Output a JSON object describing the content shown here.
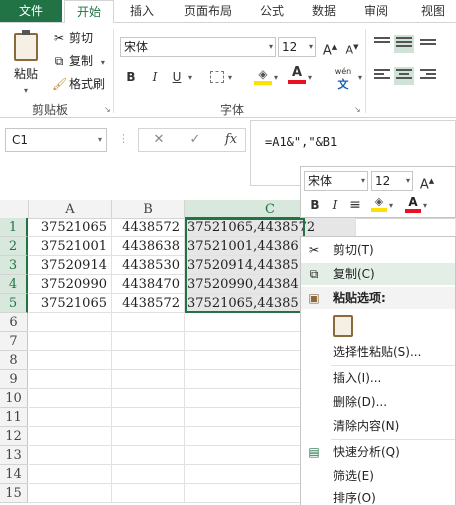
{
  "tabs": {
    "file": "文件",
    "home": "开始",
    "insert": "插入",
    "page_layout": "页面布局",
    "formulas": "公式",
    "data": "数据",
    "review": "审阅",
    "view": "视图"
  },
  "ribbon": {
    "clipboard": {
      "paste": "粘贴",
      "cut": "剪切",
      "copy": "复制",
      "format_painter": "格式刷",
      "group_label": "剪贴板"
    },
    "font": {
      "font_name": "宋体",
      "font_size": "12",
      "bold": "B",
      "italic": "I",
      "underline": "U",
      "font_color_letter": "A",
      "phonetic": "wén",
      "group_label": "字体"
    }
  },
  "formula_bar": {
    "name_box": "C1",
    "cancel": "✕",
    "confirm": "✓",
    "fx": "fx",
    "formula": "=A1&\",\"&B1"
  },
  "grid": {
    "columns": [
      "A",
      "B",
      "C"
    ],
    "rows": [
      {
        "num": "1",
        "a": "37521065",
        "b": "4438572",
        "c": "37521065,4438572"
      },
      {
        "num": "2",
        "a": "37521001",
        "b": "4438638",
        "c": "37521001,44386"
      },
      {
        "num": "3",
        "a": "37520914",
        "b": "4438530",
        "c": "37520914,44385"
      },
      {
        "num": "4",
        "a": "37520990",
        "b": "4438470",
        "c": "37520990,44384"
      },
      {
        "num": "5",
        "a": "37521065",
        "b": "4438572",
        "c": "37521065,44385"
      },
      {
        "num": "6",
        "a": "",
        "b": "",
        "c": ""
      },
      {
        "num": "7",
        "a": "",
        "b": "",
        "c": ""
      },
      {
        "num": "8",
        "a": "",
        "b": "",
        "c": ""
      },
      {
        "num": "9",
        "a": "",
        "b": "",
        "c": ""
      },
      {
        "num": "10",
        "a": "",
        "b": "",
        "c": ""
      },
      {
        "num": "11",
        "a": "",
        "b": "",
        "c": ""
      },
      {
        "num": "12",
        "a": "",
        "b": "",
        "c": ""
      },
      {
        "num": "13",
        "a": "",
        "b": "",
        "c": ""
      },
      {
        "num": "14",
        "a": "",
        "b": "",
        "c": ""
      },
      {
        "num": "15",
        "a": "",
        "b": "",
        "c": ""
      }
    ]
  },
  "mini_toolbar": {
    "font_name": "宋体",
    "font_size": "12",
    "bold": "B",
    "italic": "I",
    "font_color_letter": "A"
  },
  "context_menu": {
    "cut": "剪切(T)",
    "copy": "复制(C)",
    "paste_options": "粘贴选项:",
    "paste_special": "选择性粘贴(S)...",
    "insert": "插入(I)...",
    "delete": "删除(D)...",
    "clear_contents": "清除内容(N)",
    "quick_analysis": "快速分析(Q)",
    "filter": "筛选(E)",
    "sort": "排序(O)"
  },
  "colors": {
    "accent": "#217346",
    "selection_fill": "#e6e6e6",
    "highlight_yellow": "#ffe100",
    "font_red": "#e81123"
  }
}
